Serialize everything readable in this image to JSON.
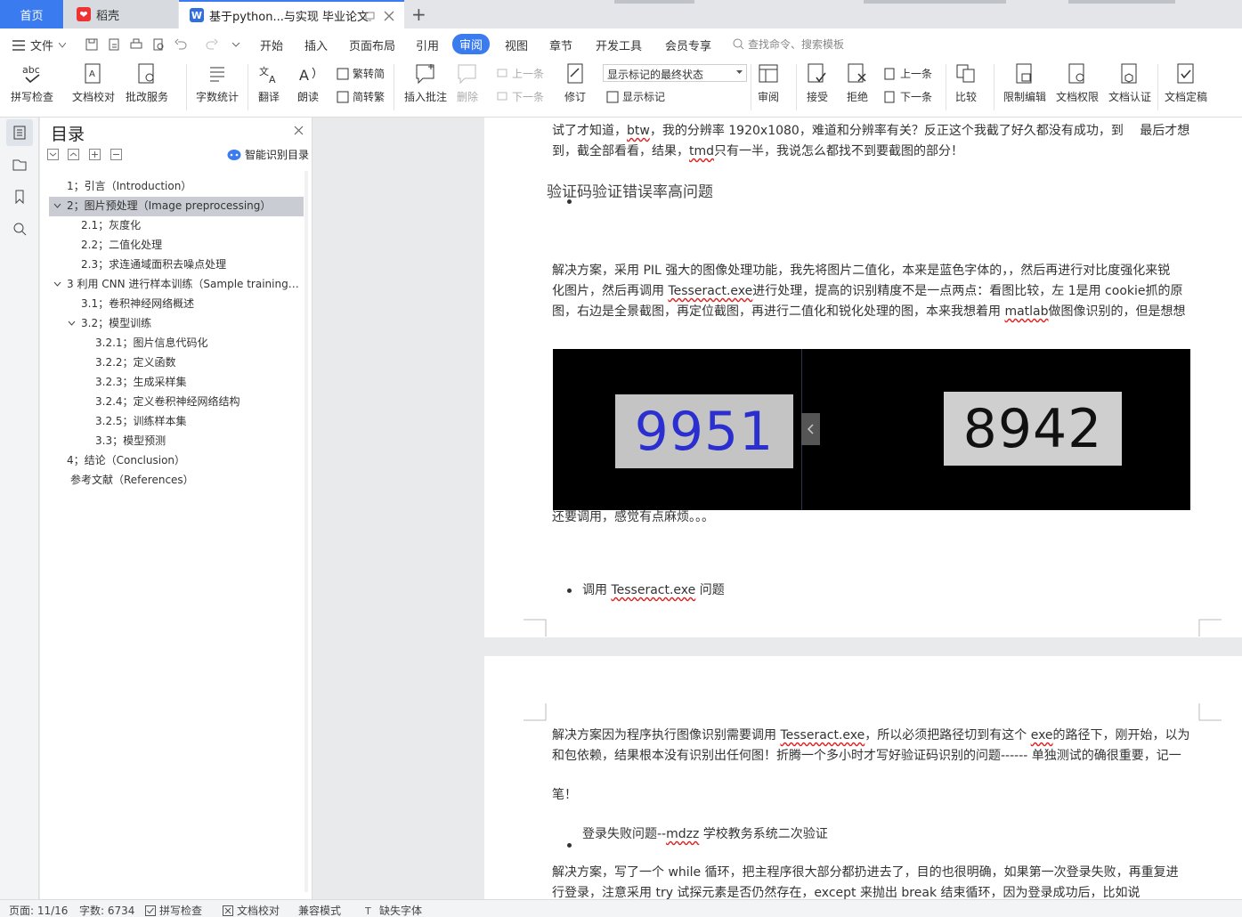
{
  "tabs": {
    "home": "首页",
    "daoke": "稻壳",
    "doc": "基于python...与实现 毕业论文"
  },
  "menu": {
    "file": "文件",
    "items": [
      "开始",
      "插入",
      "页面布局",
      "引用",
      "审阅",
      "视图",
      "章节",
      "开发工具",
      "会员专享"
    ],
    "active": "审阅",
    "search": "查找命令、搜索模板"
  },
  "ribbon": {
    "spell": "拼写检查",
    "proof": "文档校对",
    "batch": "批改服务",
    "wordcount": "字数统计",
    "translate": "翻译",
    "read": "朗读",
    "trad2simp": "繁转简",
    "simp2trad": "简转繁",
    "insert_comment": "插入批注",
    "delete": "删除",
    "prev_comment": "上一条",
    "next_comment": "下一条",
    "revise": "修订",
    "display_state": "显示标记的最终状态",
    "show_marks": "显示标记",
    "review": "审阅",
    "accept": "接受",
    "reject": "拒绝",
    "prev": "上一条",
    "next": "下一条",
    "compare": "比较",
    "restrict": "限制编辑",
    "permission": "文档权限",
    "auth": "文档认证",
    "finalize": "文档定稿"
  },
  "toc": {
    "title": "目录",
    "smart": "智能识别目录",
    "items": [
      {
        "label": "1；引言（Introduction）",
        "level": 1
      },
      {
        "label": "2；图片预处理（Image preprocessing）",
        "level": 1,
        "expanded": true,
        "selected": true
      },
      {
        "label": "2.1；灰度化",
        "level": 2
      },
      {
        "label": "2.2；二值化处理",
        "level": 2
      },
      {
        "label": "2.3；求连通域面积去噪点处理",
        "level": 2
      },
      {
        "label": "3 利用 CNN 进行样本训练（Sample training…",
        "level": 1,
        "expanded": true
      },
      {
        "label": "3.1；卷积神经网络概述",
        "level": 2
      },
      {
        "label": "3.2；模型训练",
        "level": 2,
        "expanded": true
      },
      {
        "label": "3.2.1；图片信息代码化",
        "level": 3
      },
      {
        "label": "3.2.2；定义函数",
        "level": 3
      },
      {
        "label": "3.2.3；生成采样集",
        "level": 3
      },
      {
        "label": "3.2.4；定义卷积神经网络结构",
        "level": 3
      },
      {
        "label": "3.2.5；训练样本集",
        "level": 3
      },
      {
        "label": "3.3；模型预测",
        "level": 3
      },
      {
        "label": "4；结论（Conclusion）",
        "level": 1
      },
      {
        "label": "参考文献（References）",
        "level": 1
      }
    ]
  },
  "doc": {
    "p1_line1_a": "试了才知道，",
    "p1_line1_b": "btw",
    "p1_line1_c": "，我的分辨率 1920x1080，难道和分辨率有关？反正这个我截了好久都没有成功，到　 最后才想",
    "p1_line2_a": "到，截全部看看，结果，",
    "p1_line2_b": "tmd",
    "p1_line2_c": "只有一半，我说怎么都找不到要截图的部分！",
    "heading1": "验证码验证错误率高问题",
    "p2_line1": "解决方案，采用 PIL 强大的图像处理功能，我先将图片二值化，本来是蓝色字体的，，然后再进行对比度强化来锐",
    "p2_line2_a": "化图片，然后再调用 ",
    "p2_line2_b": "Tesseract.exe",
    "p2_line2_c": "进行处理，提高的识别精度不是一点两点：看图比较，左 1是用 cookie抓的原",
    "p2_line3_a": "图，右边是全景截图，再定位截图，再进行二值化和锐化处理的图，本来我想着用 ",
    "p2_line3_b": "matlab",
    "p2_line3_c": "做图像识别的，但是想想",
    "captcha_left": "9951",
    "captcha_right": "8942",
    "after_image": "还要调用，感觉有点麻烦。。。",
    "bullet2_a": "调用 ",
    "bullet2_b": "Tesseract.exe",
    "bullet2_c": " 问题",
    "p3_line1_a": "解决方案因为程序执行图像识别需要调用 ",
    "p3_line1_b": "Tesseract.exe",
    "p3_line1_c": "，所以必须把路径切到有这个 ",
    "p3_line1_d": "exe",
    "p3_line1_e": "的路径下，刚开始，以为",
    "p3_line2": "和包依赖，结果根本没有识别出任何图！折腾一个多小时才写好验证码识别的问题------ 单独测试的确很重要，记一",
    "p3_line3": "笔！",
    "bullet3_a": "登录失败问题--",
    "bullet3_b": "mdzz",
    "bullet3_c": " 学校教务系统二次验证",
    "p4_line1": "解决方案，写了一个 while 循环，把主程序很大部分都扔进去了，目的也很明确，如果第一次登录失败，再重复进",
    "p4_line2": "行登录，注意采用 try 试探元素是否仍然存在，except 来抛出 break 结束循环，因为登录成功后，比如说"
  },
  "status": {
    "page": "页面: 11/16",
    "words": "字数: 6734",
    "spell": "拼写检查",
    "proof": "文档校对",
    "compat": "兼容模式",
    "missing_font": "缺失字体"
  },
  "colors": {
    "accent": "#3a7bf0"
  }
}
